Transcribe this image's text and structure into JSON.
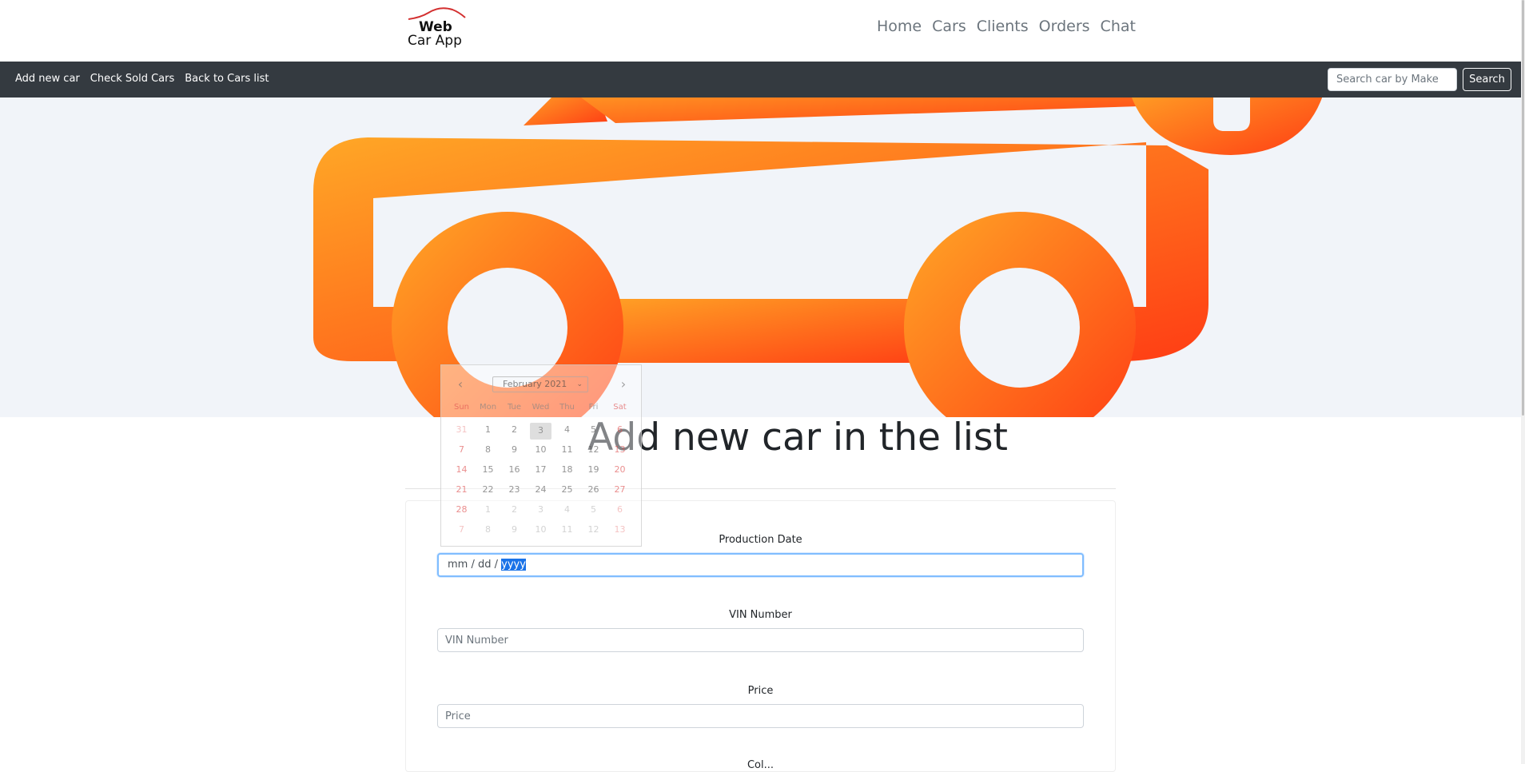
{
  "brand": {
    "line1": "Web",
    "line2": "Car App"
  },
  "topnav": [
    "Home",
    "Cars",
    "Clients",
    "Orders",
    "Chat"
  ],
  "subnav": {
    "links": [
      "Add new car",
      "Check Sold Cars",
      "Back to Cars list"
    ],
    "search_placeholder": "Search car by Make",
    "search_button": "Search"
  },
  "page_title": "Add new car in the list",
  "form": {
    "production_date_label": "Production Date",
    "production_date_value": {
      "mm": "mm",
      "dd": "dd",
      "yyyy": "yyyy"
    },
    "vin_label": "VIN Number",
    "vin_placeholder": "VIN Number",
    "price_label": "Price",
    "price_placeholder": "Price",
    "next_label_partial": "Col..."
  },
  "calendar": {
    "month": "February 2021",
    "weekdays": [
      "Sun",
      "Mon",
      "Tue",
      "Wed",
      "Thu",
      "Fri",
      "Sat"
    ],
    "days": [
      "31",
      "1",
      "2",
      "3",
      "4",
      "5",
      "6",
      "7",
      "8",
      "9",
      "10",
      "11",
      "12",
      "13",
      "14",
      "15",
      "16",
      "17",
      "18",
      "19",
      "20",
      "21",
      "22",
      "23",
      "24",
      "25",
      "26",
      "27",
      "28",
      "1",
      "2",
      "3",
      "4",
      "5",
      "6",
      "7",
      "8",
      "9",
      "10",
      "11",
      "12",
      "13"
    ],
    "today": "3"
  },
  "colors": {
    "subnav_bg": "#343a40",
    "hero_bg": "#f1f4f9",
    "accent_orange": "#ff7a1a",
    "focus_blue": "#80bdff"
  }
}
